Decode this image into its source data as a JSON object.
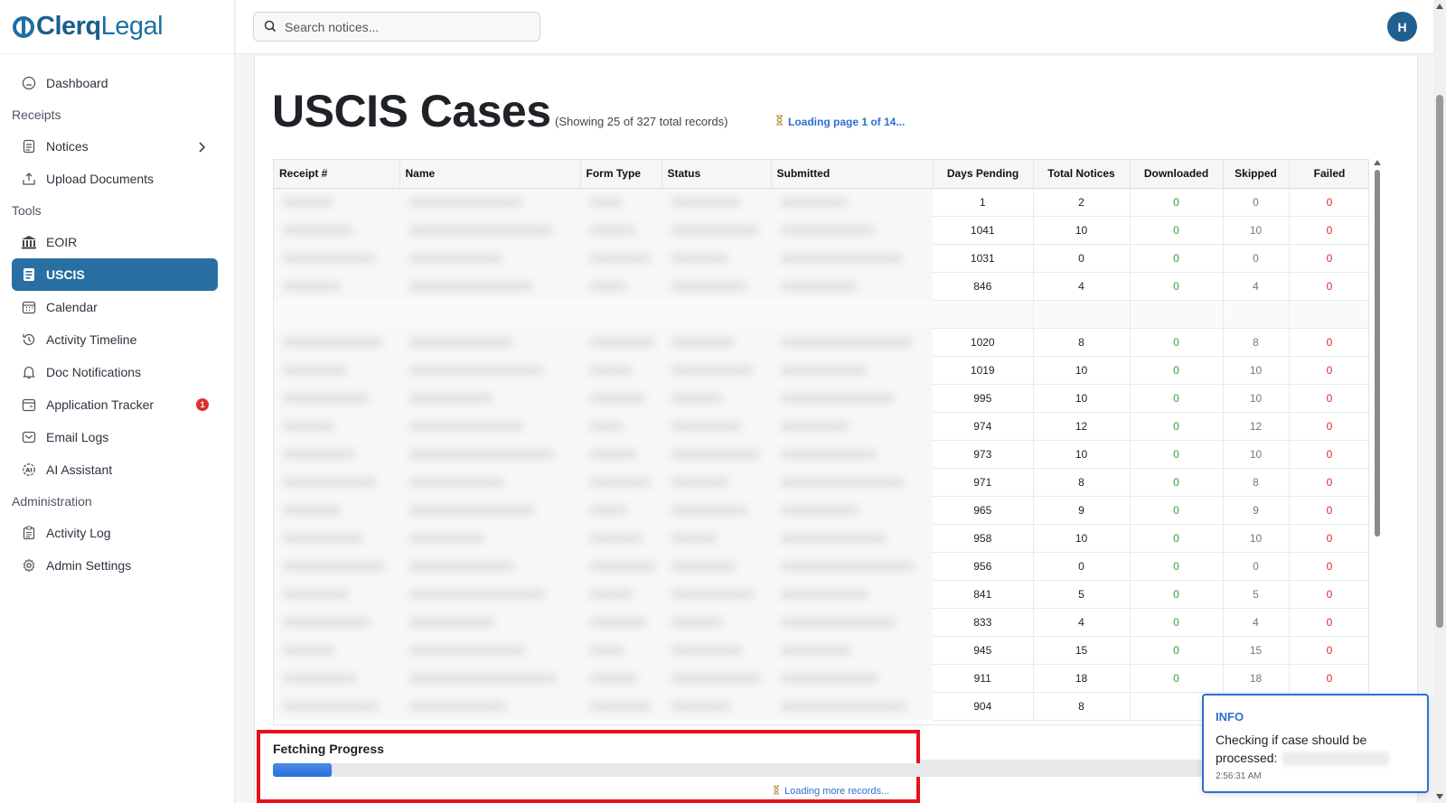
{
  "brand": {
    "name_part1": "Clerq",
    "name_part2": "Legal"
  },
  "search": {
    "placeholder": "Search notices..."
  },
  "user": {
    "initial": "H"
  },
  "sidebar": {
    "items": [
      {
        "label": "Dashboard",
        "icon": "home-icon"
      },
      {
        "section": "Receipts"
      },
      {
        "label": "Notices",
        "icon": "document-icon",
        "has_submenu": true
      },
      {
        "label": "Upload Documents",
        "icon": "upload-icon"
      },
      {
        "section": "Tools"
      },
      {
        "label": "EOIR",
        "icon": "courthouse-icon"
      },
      {
        "label": "USCIS",
        "icon": "id-card-icon",
        "active": true
      },
      {
        "label": "Calendar",
        "icon": "calendar-icon"
      },
      {
        "label": "Activity Timeline",
        "icon": "history-icon"
      },
      {
        "label": "Doc Notifications",
        "icon": "bell-icon"
      },
      {
        "label": "Application Tracker",
        "icon": "tracker-icon",
        "badge": "1"
      },
      {
        "label": "Email Logs",
        "icon": "mail-icon"
      },
      {
        "label": "AI Assistant",
        "icon": "ai-icon"
      },
      {
        "section": "Administration"
      },
      {
        "label": "Activity Log",
        "icon": "clipboard-icon"
      },
      {
        "label": "Admin Settings",
        "icon": "gear-icon"
      }
    ]
  },
  "page": {
    "title": "USCIS Cases",
    "subtitle": "(Showing 25 of 327 total records)",
    "loading_status": "Loading page 1 of 14..."
  },
  "table": {
    "columns": [
      "Receipt #",
      "Name",
      "Form Type",
      "Status",
      "Submitted",
      "Days Pending",
      "Total Notices",
      "Downloaded",
      "Skipped",
      "Failed"
    ],
    "rows": [
      {
        "days_pending": "1",
        "total_notices": "2",
        "downloaded": "0",
        "skipped": "0",
        "failed": "0"
      },
      {
        "days_pending": "1041",
        "total_notices": "10",
        "downloaded": "0",
        "skipped": "10",
        "failed": "0"
      },
      {
        "days_pending": "1031",
        "total_notices": "0",
        "downloaded": "0",
        "skipped": "0",
        "failed": "0"
      },
      {
        "days_pending": "846",
        "total_notices": "4",
        "downloaded": "0",
        "skipped": "4",
        "failed": "0"
      },
      {
        "spacer": true
      },
      {
        "days_pending": "1020",
        "total_notices": "8",
        "downloaded": "0",
        "skipped": "8",
        "failed": "0"
      },
      {
        "days_pending": "1019",
        "total_notices": "10",
        "downloaded": "0",
        "skipped": "10",
        "failed": "0"
      },
      {
        "days_pending": "995",
        "total_notices": "10",
        "downloaded": "0",
        "skipped": "10",
        "failed": "0"
      },
      {
        "days_pending": "974",
        "total_notices": "12",
        "downloaded": "0",
        "skipped": "12",
        "failed": "0"
      },
      {
        "days_pending": "973",
        "total_notices": "10",
        "downloaded": "0",
        "skipped": "10",
        "failed": "0"
      },
      {
        "days_pending": "971",
        "total_notices": "8",
        "downloaded": "0",
        "skipped": "8",
        "failed": "0"
      },
      {
        "days_pending": "965",
        "total_notices": "9",
        "downloaded": "0",
        "skipped": "9",
        "failed": "0"
      },
      {
        "days_pending": "958",
        "total_notices": "10",
        "downloaded": "0",
        "skipped": "10",
        "failed": "0"
      },
      {
        "days_pending": "956",
        "total_notices": "0",
        "downloaded": "0",
        "skipped": "0",
        "failed": "0"
      },
      {
        "days_pending": "841",
        "total_notices": "5",
        "downloaded": "0",
        "skipped": "5",
        "failed": "0"
      },
      {
        "days_pending": "833",
        "total_notices": "4",
        "downloaded": "0",
        "skipped": "4",
        "failed": "0"
      },
      {
        "days_pending": "945",
        "total_notices": "15",
        "downloaded": "0",
        "skipped": "15",
        "failed": "0"
      },
      {
        "days_pending": "911",
        "total_notices": "18",
        "downloaded": "0",
        "skipped": "18",
        "failed": "0"
      },
      {
        "days_pending": "904",
        "total_notices": "8",
        "downloaded": "",
        "skipped": "",
        "failed": ""
      }
    ]
  },
  "progress": {
    "title": "Fetching Progress",
    "fraction": 0.07,
    "note": "Loading more records..."
  },
  "toast": {
    "type": "INFO",
    "message": "Checking if case should be processed:",
    "time": "2:56:31 AM"
  },
  "colors": {
    "accent": "#2a6fa3",
    "link": "#2d6fd0",
    "success": "#2e9b3a",
    "danger": "#d9302a",
    "highlight_border": "#e8111a"
  }
}
